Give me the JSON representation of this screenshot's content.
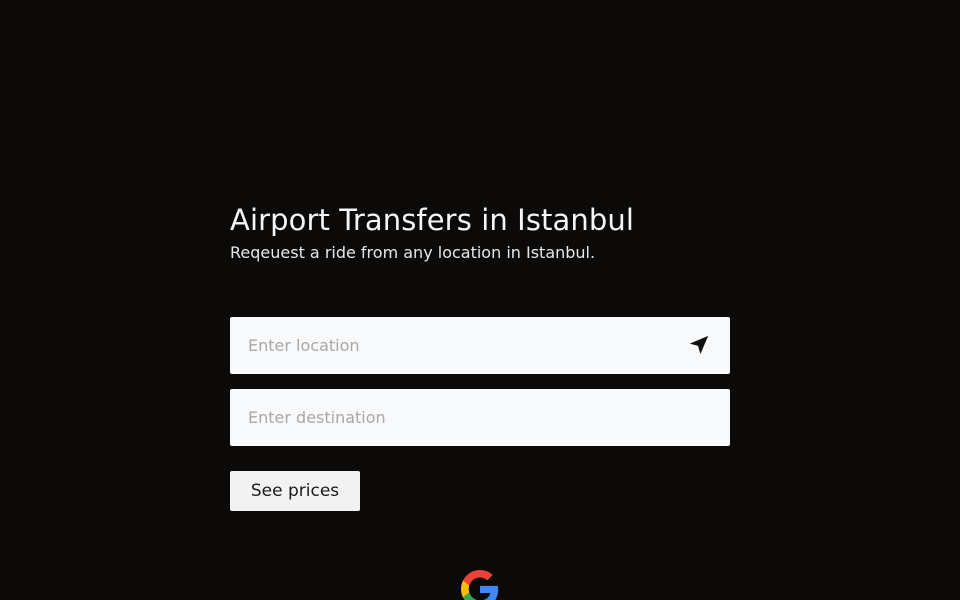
{
  "hero": {
    "title": "Airport Transfers in Istanbul",
    "subtitle": "Reqeuest a ride from any location in Istanbul."
  },
  "location_field": {
    "value": "",
    "placeholder": "Enter location",
    "icon": "navigation-arrow-icon"
  },
  "destination_field": {
    "value": "",
    "placeholder": "Enter destination"
  },
  "see_prices_button": {
    "label": "See prices"
  },
  "footer": {
    "logo_icon": "google-logo-icon"
  },
  "colors": {
    "background": "#0c0a09",
    "field_background": "#f8f9fb",
    "button_background": "#f2f2f2",
    "text_primary": "#f5f5f5"
  }
}
